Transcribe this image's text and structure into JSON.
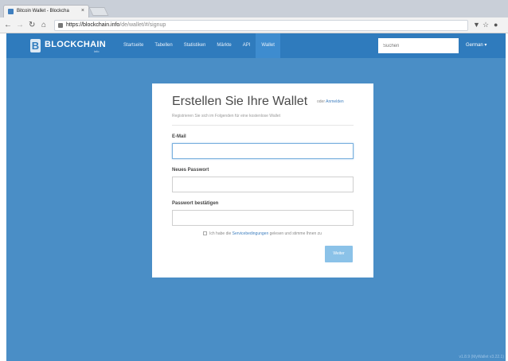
{
  "browser": {
    "tab_title": "Bitcoin Wallet - Blockcha",
    "tab_close": "×",
    "url_host": "https://blockchain.info",
    "url_path": "/de/wallet/#/signup"
  },
  "nav": {
    "logo_text": "BLOCKCHAIN",
    "logo_sub": "info",
    "links": [
      "Startseite",
      "Tabellen",
      "Statistiken",
      "Märkte",
      "API",
      "Wallet"
    ],
    "active_link": "Wallet",
    "search_placeholder": "Suchen",
    "language": "German ▾"
  },
  "signup": {
    "title": "Erstellen Sie Ihre Wallet",
    "login_prefix": "oder",
    "login_link": "Anmelden",
    "subtitle": "Registrieren Sie sich im Folgenden für eine kostenlose Wallet",
    "email_label": "E-Mail",
    "password_label": "Neues Passwort",
    "confirm_label": "Passwort bestätigen",
    "terms_prefix": "Ich habe die",
    "terms_link": "Servicebedingungen",
    "terms_suffix": "gelesen und stimme Ihnen zu",
    "submit_label": "Weiter"
  },
  "footer": {
    "version": "v1.8.9 (MyWallet v3.22.1)"
  },
  "colors": {
    "page_background": "#4a8ec6",
    "nav_background": "#2f7bbd",
    "button": "#8bc2e8"
  }
}
